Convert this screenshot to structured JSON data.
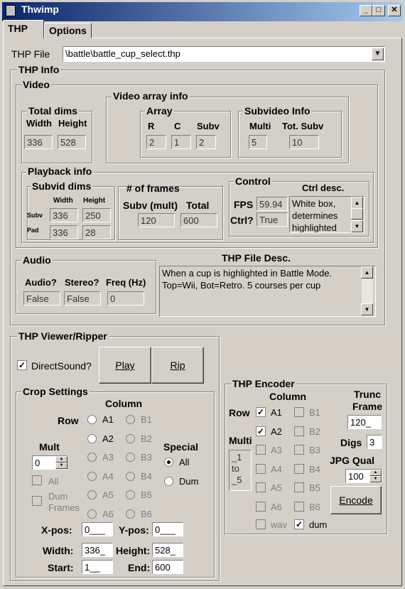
{
  "window": {
    "title": "Thwimp",
    "min": "_",
    "max": "□",
    "close": "✕"
  },
  "tabs": [
    "THP",
    "Options"
  ],
  "file": {
    "label": "THP File",
    "value": "\\battle\\battle_cup_select.thp"
  },
  "info": {
    "title": "THP Info",
    "video": {
      "title": "Video",
      "total": {
        "title": "Total dims",
        "width_label": "Width",
        "height_label": "Height",
        "width": "336",
        "height": "528"
      },
      "array_info": {
        "title": "Video array info",
        "array": {
          "title": "Array",
          "r_label": "R",
          "c_label": "C",
          "subv_label": "Subv",
          "r": "2",
          "c": "1",
          "subv": "2"
        },
        "subvideo": {
          "title": "Subvideo Info",
          "multi_label": "Multi",
          "tot_label": "Tot. Subv",
          "multi": "5",
          "tot": "10"
        }
      },
      "playback": {
        "title": "Playback info",
        "subvid": {
          "title": "Subvid dims",
          "width_label": "Width",
          "height_label": "Height",
          "subv_label": "Subv",
          "pad_label": "Pad",
          "subv_w": "336",
          "subv_h": "250",
          "pad_w": "336",
          "pad_h": "28"
        },
        "frames": {
          "title": "# of frames",
          "subv_label": "Subv (mult)",
          "total_label": "Total",
          "subv": "120",
          "total": "600"
        },
        "control": {
          "title": "Control",
          "fps_label": "FPS",
          "fps": "59.94",
          "ctrl_label": "Ctrl?",
          "ctrl": "True",
          "desc_label": "Ctrl desc.",
          "desc": "White box, determines highlighted"
        }
      }
    },
    "audio": {
      "title": "Audio",
      "audio_label": "Audio?",
      "stereo_label": "Stereo?",
      "freq_label": "Freq (Hz)",
      "audio": "False",
      "stereo": "False",
      "freq": "0"
    },
    "desc": {
      "title": "THP File Desc.",
      "text": "When a cup is highlighted in Battle Mode. Top=Wii, Bot=Retro. 5 courses per cup"
    }
  },
  "viewer": {
    "title": "THP Viewer/Ripper",
    "directsound": "DirectSound?",
    "play": "Play",
    "rip": "Rip",
    "crop": {
      "title": "Crop Settings",
      "column": "Column",
      "row": "Row",
      "cells": [
        "A1",
        "B1",
        "A2",
        "B2",
        "A3",
        "B3",
        "A4",
        "B4",
        "A5",
        "B5",
        "A6",
        "B6"
      ],
      "mult_label": "Mult",
      "mult": "0",
      "all": "All",
      "dum_frames": "Dum Frames",
      "special": "Special",
      "special_all": "All",
      "special_dum": "Dum",
      "xpos_label": "X-pos:",
      "xpos": "0___",
      "ypos_label": "Y-pos:",
      "ypos": "0___",
      "width_label": "Width:",
      "width": "336_",
      "height_label": "Height:",
      "height": "528_",
      "start_label": "Start:",
      "start": "1__",
      "end_label": "End:",
      "end": "600"
    }
  },
  "encoder": {
    "title": "THP Encoder",
    "column": "Column",
    "row": "Row",
    "multi": "Multi",
    "multi_text": "_1\nto\n_5",
    "cells": [
      "A1",
      "B1",
      "A2",
      "B2",
      "A3",
      "B3",
      "A4",
      "B4",
      "A5",
      "B5",
      "A6",
      "B6"
    ],
    "wav": "wav",
    "dum": "dum",
    "trunc": "Trunc Frame",
    "trunc_value": "120_",
    "digs_label": "Digs",
    "digs": "3",
    "jpg_label": "JPG Qual",
    "jpg": "100",
    "encode": "Encode"
  }
}
